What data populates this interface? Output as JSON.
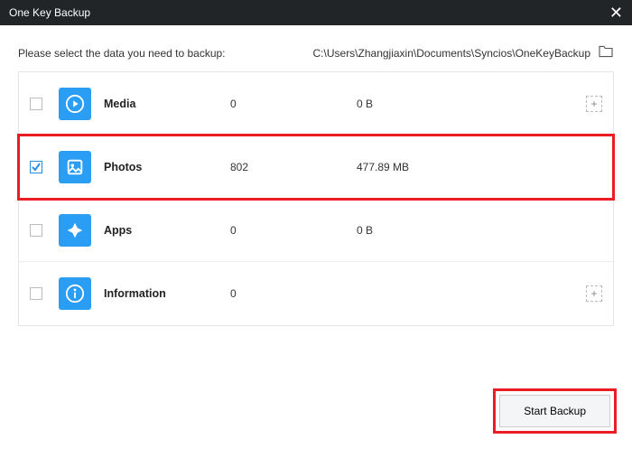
{
  "window": {
    "title": "One Key Backup"
  },
  "instruction": "Please select the data you need to backup:",
  "backup_path": "C:\\Users\\Zhangjiaxin\\Documents\\Syncios\\OneKeyBackup",
  "categories": [
    {
      "id": "media",
      "label": "Media",
      "count": "0",
      "size": "0 B",
      "checked": false,
      "has_add": true
    },
    {
      "id": "photos",
      "label": "Photos",
      "count": "802",
      "size": "477.89 MB",
      "checked": true,
      "has_add": false
    },
    {
      "id": "apps",
      "label": "Apps",
      "count": "0",
      "size": "0 B",
      "checked": false,
      "has_add": false
    },
    {
      "id": "info",
      "label": "Information",
      "count": "0",
      "size": "",
      "checked": false,
      "has_add": true
    }
  ],
  "buttons": {
    "start": "Start Backup"
  }
}
